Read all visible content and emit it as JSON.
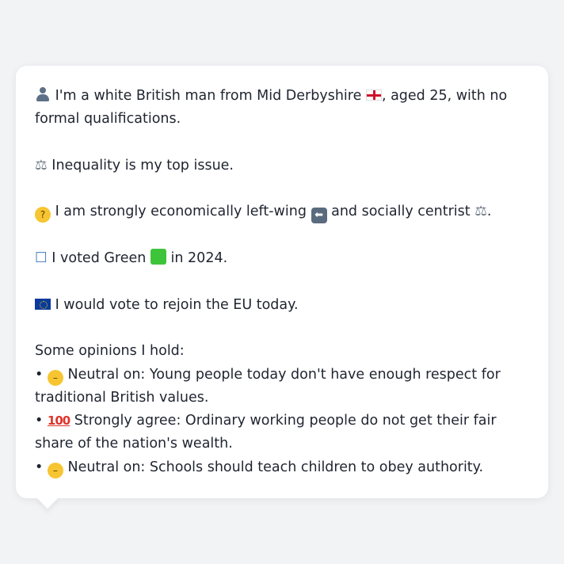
{
  "lines": {
    "intro_a": "I'm a white British man from Mid Derbyshire",
    "intro_b": ", aged 25, with no formal qualifications.",
    "issue": "Inequality is my top issue.",
    "stance_a": "I am strongly economically left-wing",
    "stance_b": "and socially centrist",
    "stance_end": ".",
    "vote_a": "I voted Green",
    "vote_b": "in 2024.",
    "eu": "I would vote to rejoin the EU today.",
    "opinions_header": "Some opinions I hold:"
  },
  "opinions": [
    {
      "bullet": "•",
      "stance": "Neutral on:",
      "text": "Young people today don't have enough respect for traditional British values."
    },
    {
      "bullet": "•",
      "stance": "Strongly agree:",
      "text": "Ordinary working people do not get their fair share of the nation's wealth."
    },
    {
      "bullet": "•",
      "stance": "Neutral on:",
      "text": "Schools should teach children to obey authority."
    }
  ],
  "icons": {
    "person": "person-icon",
    "england_flag": "england-flag-icon",
    "scale": "balance-scale-icon",
    "thinking": "thinking-face-icon",
    "left_arrow": "left-arrow-icon",
    "ballot": "ballot-box-icon",
    "green_square": "green-square-icon",
    "eu_flag": "eu-flag-icon",
    "neutral_face": "neutral-face-icon",
    "hundred": "hundred-points-icon"
  },
  "colors": {
    "background": "#f2f3f5",
    "card": "#ffffff",
    "text": "#1f2430",
    "green": "#3ec43a"
  }
}
